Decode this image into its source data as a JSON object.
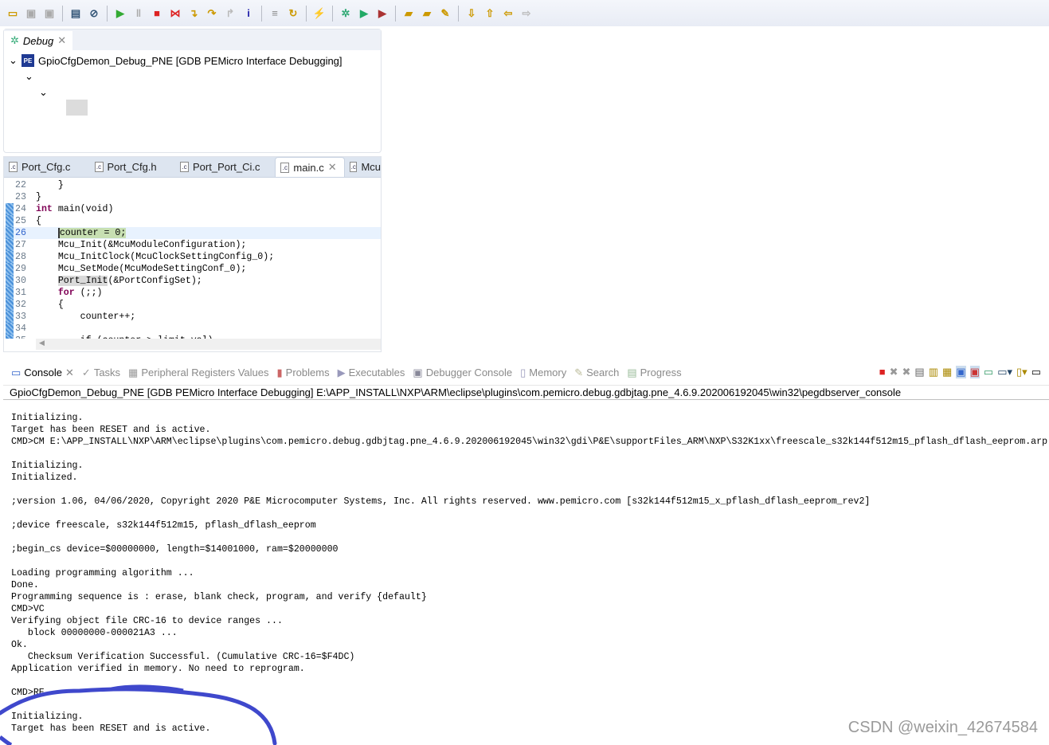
{
  "toolbar": {
    "icons": [
      "new-icon",
      "save-icon",
      "save-all-icon",
      "binary-icon",
      "skip-breakpoints-icon",
      "resume-icon",
      "suspend-icon",
      "terminate-icon",
      "disconnect-icon",
      "step-into-icon",
      "step-over-icon",
      "step-return-icon",
      "instruction-step-icon",
      "use-step-filters-icon",
      "restart-icon",
      "lightning-icon",
      "debug-icon",
      "run-icon",
      "external-tools-icon",
      "open-folder-icon",
      "search-icon",
      "marker-icon",
      "next-annotation-icon",
      "prev-annotation-icon",
      "back-icon",
      "forward-icon"
    ]
  },
  "debug_view": {
    "tab_label": "Debug",
    "session": "GpioCfgDemon_Debug_PNE [GDB PEMicro Interface Debugging]",
    "logo": "PE"
  },
  "editor": {
    "tabs": [
      {
        "label": "Port_Cfg.c"
      },
      {
        "label": "Port_Cfg.h"
      },
      {
        "label": "Port_Port_Ci.c"
      },
      {
        "label": "main.c",
        "active": true
      },
      {
        "label": "Mcu"
      }
    ],
    "lines": [
      {
        "n": "22",
        "text": "    }"
      },
      {
        "n": "23",
        "text": "}"
      },
      {
        "n": "24",
        "kw": "int",
        "text": " main(void)"
      },
      {
        "n": "25",
        "text": "{"
      },
      {
        "n": "26",
        "pre": "    ",
        "hl": "counter = 0;",
        "current": true
      },
      {
        "n": "27",
        "text": "    Mcu_Init(&McuModuleConfiguration);"
      },
      {
        "n": "28",
        "text": "    Mcu_InitClock(McuClockSettingConfig_0);"
      },
      {
        "n": "29",
        "text": "    Mcu_SetMode(McuModeSettingConf_0);"
      },
      {
        "n": "30",
        "pre": "    ",
        "gray": "Port_Init",
        "text": "(&PortConfigSet);"
      },
      {
        "n": "31",
        "pre": "    ",
        "kw": "for",
        "text": " (;;)"
      },
      {
        "n": "32",
        "text": "    {"
      },
      {
        "n": "33",
        "text": "        counter++;"
      },
      {
        "n": "34",
        "text": ""
      },
      {
        "n": "35",
        "text": "        if (counter > limit_val)"
      }
    ]
  },
  "console": {
    "tabs": [
      {
        "label": "Console",
        "active": true
      },
      {
        "label": "Tasks"
      },
      {
        "label": "Peripheral Registers Values"
      },
      {
        "label": "Problems"
      },
      {
        "label": "Executables"
      },
      {
        "label": "Debugger Console"
      },
      {
        "label": "Memory"
      },
      {
        "label": "Search"
      },
      {
        "label": "Progress"
      }
    ],
    "path": "GpioCfgDemon_Debug_PNE [GDB PEMicro Interface Debugging] E:\\APP_INSTALL\\NXP\\ARM\\eclipse\\plugins\\com.pemicro.debug.gdbjtag.pne_4.6.9.202006192045\\win32\\pegdbserver_console",
    "output": "Initializing.\nTarget has been RESET and is active.\nCMD>CM E:\\APP_INSTALL\\NXP\\ARM\\eclipse\\plugins\\com.pemicro.debug.gdbjtag.pne_4.6.9.202006192045\\win32\\gdi\\P&E\\supportFiles_ARM\\NXP\\S32K1xx\\freescale_s32k144f512m15_pflash_dflash_eeprom.arp\n\nInitializing.\nInitialized.\n\n;version 1.06, 04/06/2020, Copyright 2020 P&E Microcomputer Systems, Inc. All rights reserved. www.pemicro.com [s32k144f512m15_x_pflash_dflash_eeprom_rev2]\n\n;device freescale, s32k144f512m15, pflash_dflash_eeprom\n\n;begin_cs device=$00000000, length=$14001000, ram=$20000000\n\nLoading programming algorithm ...\nDone.\nProgramming sequence is : erase, blank check, program, and verify {default}\nCMD>VC\nVerifying object file CRC-16 to device ranges ...\n   block 00000000-000021A3 ...\nOk.\n   Checksum Verification Successful. (Cumulative CRC-16=$F4DC)\nApplication verified in memory. No need to reprogram.\n\nCMD>RE\n\nInitializing.\nTarget has been RESET and is active."
  },
  "watermark": "CSDN @weixin_42674584",
  "colors": {
    "annotation": "#3f48cc",
    "keyword": "#7f0055",
    "current_line": "#c7dfb2"
  }
}
